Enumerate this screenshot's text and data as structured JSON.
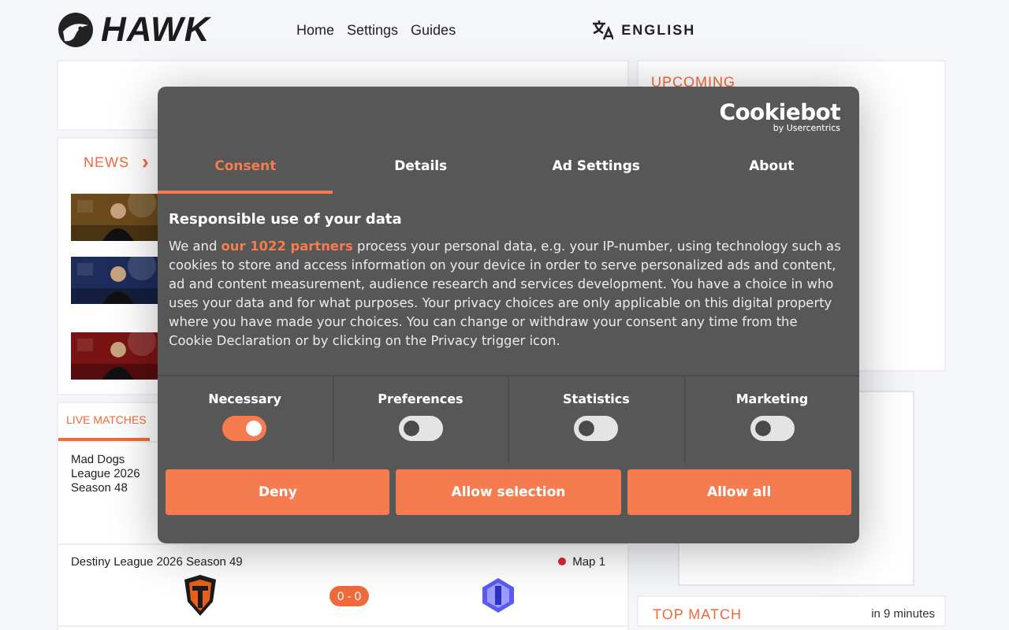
{
  "header": {
    "logo": "HAWK",
    "nav": [
      {
        "label": "Home"
      },
      {
        "label": "Settings"
      },
      {
        "label": "Guides"
      }
    ],
    "language": "ENGLISH"
  },
  "news": {
    "title": "NEWS",
    "arrow": "›"
  },
  "upcoming": {
    "title": "UPCOMING"
  },
  "live": {
    "tabs": [
      {
        "label": "LIVE MATCHES",
        "selected": true
      }
    ],
    "matches": [
      {
        "league": "Mad Dogs League 2026 Season 48"
      },
      {
        "league": "Destiny League 2026 Season 49",
        "map": "Map 1",
        "score": "0 - 0"
      }
    ]
  },
  "top_match": {
    "title": "TOP MATCH",
    "time": "in 9 minutes"
  },
  "consent": {
    "brand": "Cookiebot",
    "brand_sub": "by Usercentrics",
    "tabs": [
      {
        "label": "Consent",
        "selected": true
      },
      {
        "label": "Details",
        "selected": false
      },
      {
        "label": "Ad Settings",
        "selected": false
      },
      {
        "label": "About",
        "selected": false
      }
    ],
    "heading": "Responsible use of your data",
    "text": [
      {
        "kind": "text",
        "value": "We and "
      },
      {
        "kind": "link",
        "value": "our 1022 partners"
      },
      {
        "kind": "text",
        "value": " process your personal data, e.g. your IP-number, using technology such as cookies to store and access information on your device in order to serve personalized ads and content, ad and content measurement, audience research and services development. You have a choice in who uses your data and for what purposes. Your privacy choices are only applicable on this digital property where you have made your choices. You can change or withdraw your consent any time from the Cookie Declaration or by clicking on the Privacy trigger icon."
      }
    ],
    "toggles": [
      {
        "label": "Necessary",
        "on": true
      },
      {
        "label": "Preferences",
        "on": false
      },
      {
        "label": "Statistics",
        "on": false
      },
      {
        "label": "Marketing",
        "on": false
      }
    ],
    "buttons": [
      "Deny",
      "Allow selection",
      "Allow all"
    ]
  }
}
